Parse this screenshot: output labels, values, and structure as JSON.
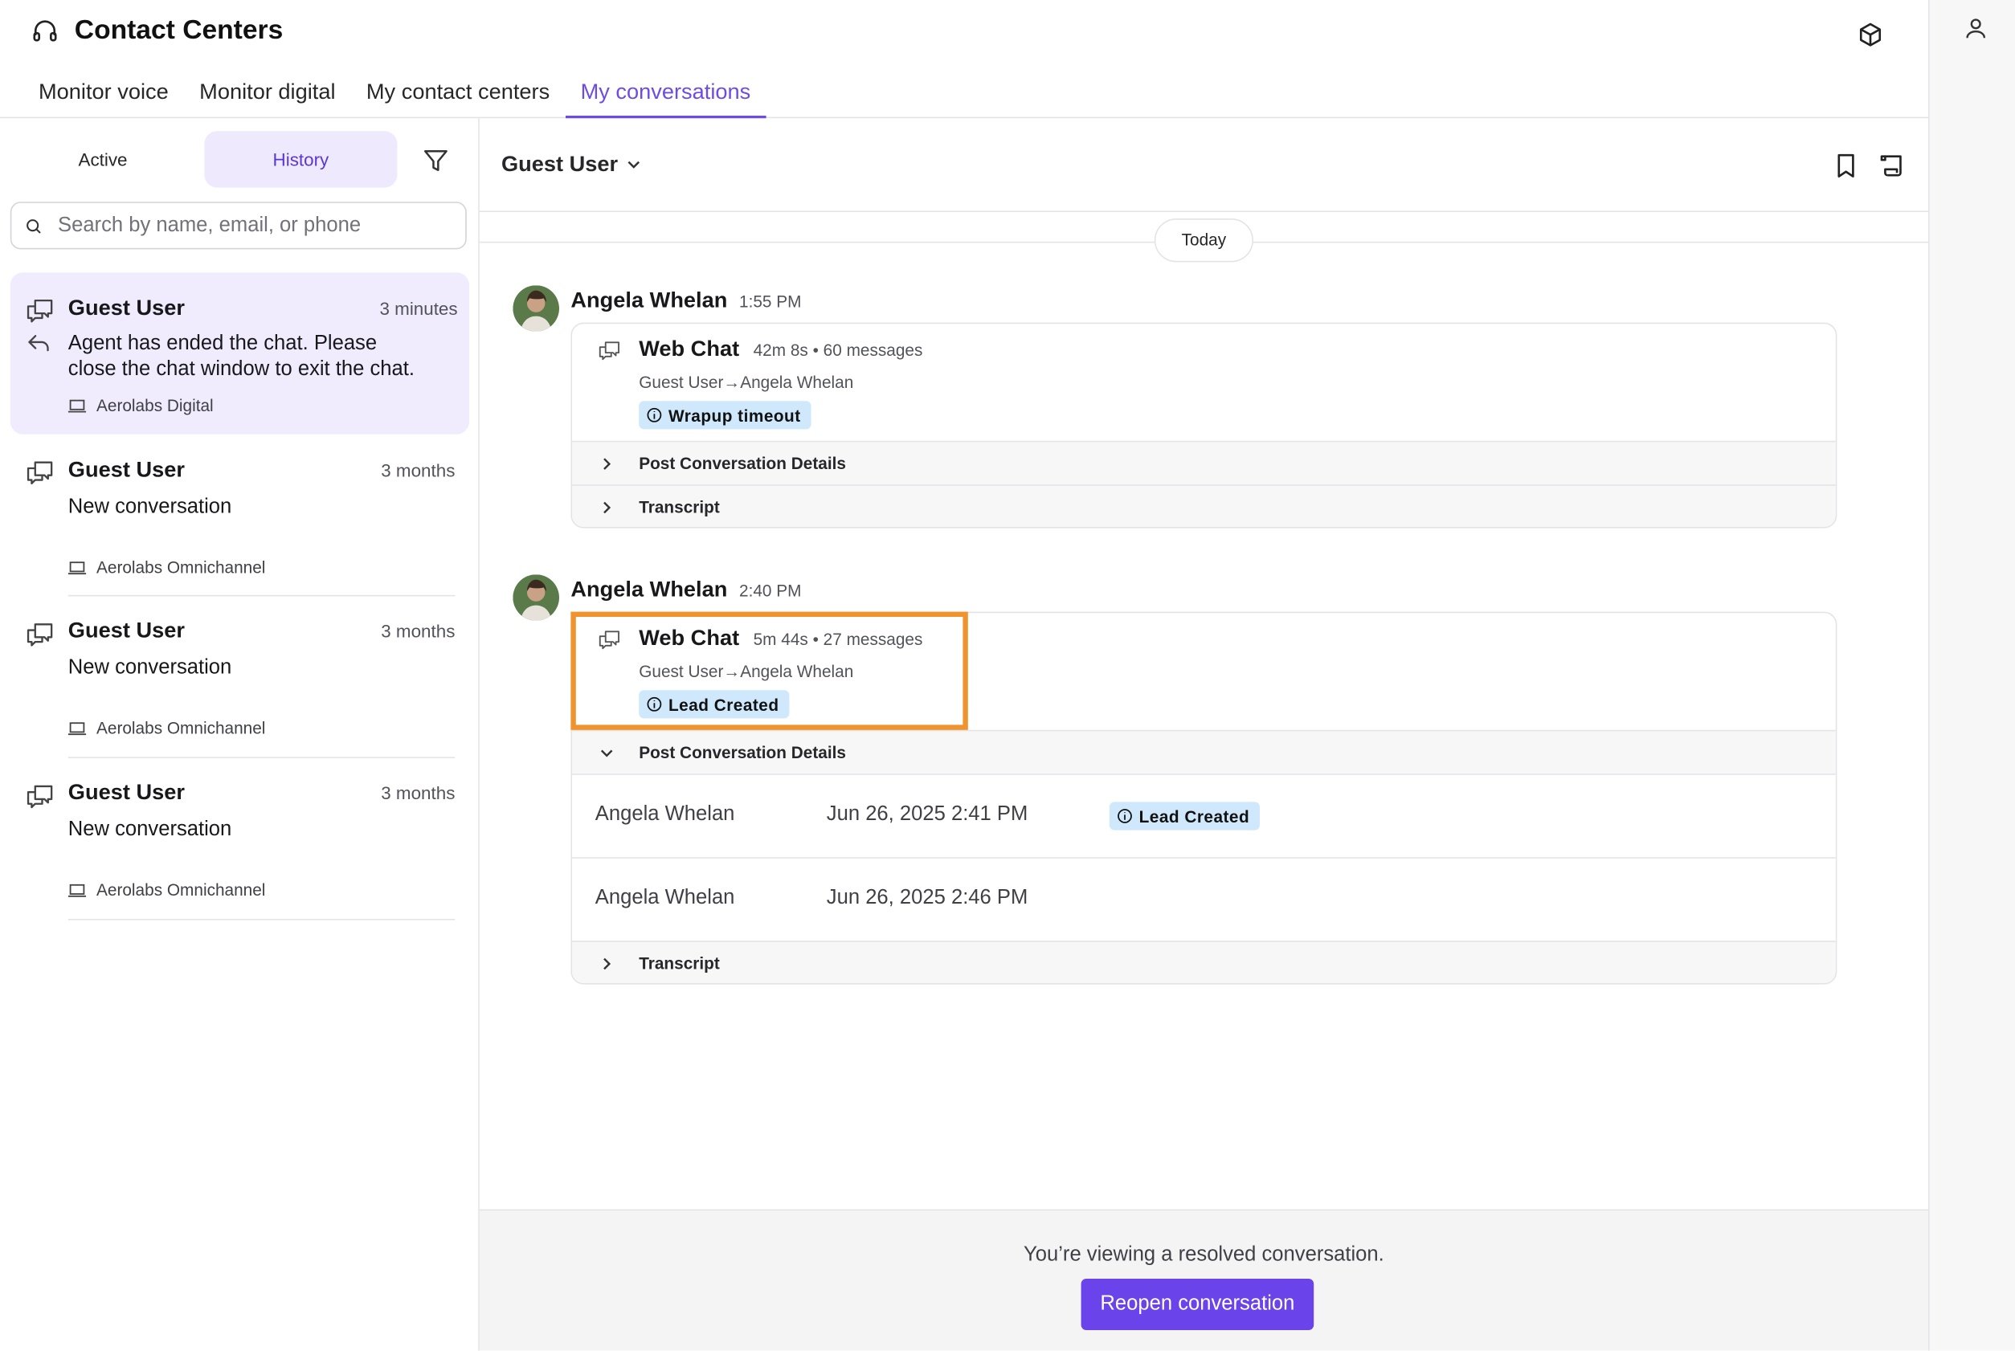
{
  "app": {
    "title": "Contact Centers",
    "icon": "headset-icon"
  },
  "tabs": [
    {
      "label": "Monitor voice",
      "active": false
    },
    {
      "label": "Monitor digital",
      "active": false
    },
    {
      "label": "My contact centers",
      "active": false
    },
    {
      "label": "My conversations",
      "active": true
    }
  ],
  "left": {
    "segments": {
      "active_label": "Active",
      "history_label": "History",
      "selected": "History"
    },
    "search": {
      "placeholder": "Search by name, email, or phone",
      "value": ""
    },
    "conversations": [
      {
        "name": "Guest User",
        "time": "3 minutes",
        "preview_line1": "Agent has ended the chat. Please",
        "preview_line2": "close the chat window to exit the chat.",
        "channel": "Aerolabs Digital",
        "selected": true
      },
      {
        "name": "Guest User",
        "time": "3 months",
        "preview": "New conversation",
        "channel": "Aerolabs Omnichannel"
      },
      {
        "name": "Guest User",
        "time": "3 months",
        "preview": "New conversation",
        "channel": "Aerolabs Omnichannel"
      },
      {
        "name": "Guest User",
        "time": "3 months",
        "preview": "New conversation",
        "channel": "Aerolabs Omnichannel"
      }
    ]
  },
  "main": {
    "contact_selector": "Guest User",
    "day_separator": "Today",
    "messages": [
      {
        "sender": "Angela Whelan",
        "time": "1:55 PM",
        "channel_title": "Web Chat",
        "meta": "42m 8s • 60 messages",
        "route_from": "Guest User",
        "route_to": "Angela Whelan",
        "badge": "Wrapup timeout",
        "post_details_label": "Post Conversation Details",
        "transcript_label": "Transcript"
      },
      {
        "sender": "Angela Whelan",
        "time": "2:40 PM",
        "channel_title": "Web Chat",
        "meta": "5m 44s • 27 messages",
        "route_from": "Guest User",
        "route_to": "Angela Whelan",
        "badge": "Lead Created",
        "post_details_label": "Post Conversation Details",
        "post_details": [
          {
            "agent": "Angela Whelan",
            "date": "Jun 26, 2025 2:41 PM",
            "badge": "Lead Created"
          },
          {
            "agent": "Angela Whelan",
            "date": "Jun 26, 2025 2:46 PM"
          }
        ],
        "transcript_label": "Transcript"
      }
    ],
    "footer": {
      "message": "You’re viewing a resolved conversation.",
      "button": "Reopen conversation"
    }
  },
  "colors": {
    "accent": "#6a43ea",
    "tab_active": "#6d4ce6",
    "badge_bg": "#cfe8fb",
    "highlight": "#f0922d",
    "selected_bg": "#f0ebfd"
  }
}
